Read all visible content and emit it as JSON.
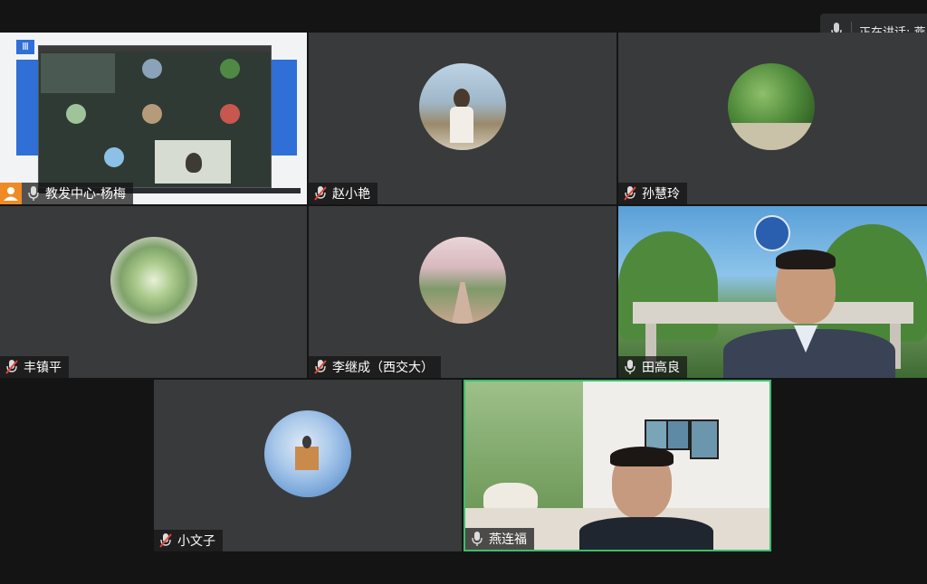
{
  "colors": {
    "background": "#141414",
    "tile": "#393a3b",
    "active_border": "#3bbf6d",
    "accent_orange": "#f08a24"
  },
  "speaking_indicator": {
    "label": "正在讲话: 燕",
    "icon": "mic-icon"
  },
  "participants": [
    {
      "name": "教发中心-杨梅",
      "mic": "mic-on",
      "sharing_screen": true
    },
    {
      "name": "赵小艳",
      "mic": "mic-muted"
    },
    {
      "name": "孙慧玲",
      "mic": "mic-muted"
    },
    {
      "name": "丰镇平",
      "mic": "mic-muted"
    },
    {
      "name": "李继成（西交大）",
      "mic": "mic-muted"
    },
    {
      "name": "田高良",
      "mic": "mic-on",
      "video": true
    },
    {
      "name": "小文子",
      "mic": "mic-muted"
    },
    {
      "name": "燕连福",
      "mic": "mic-on",
      "video": true,
      "active_speaker": true
    }
  ]
}
